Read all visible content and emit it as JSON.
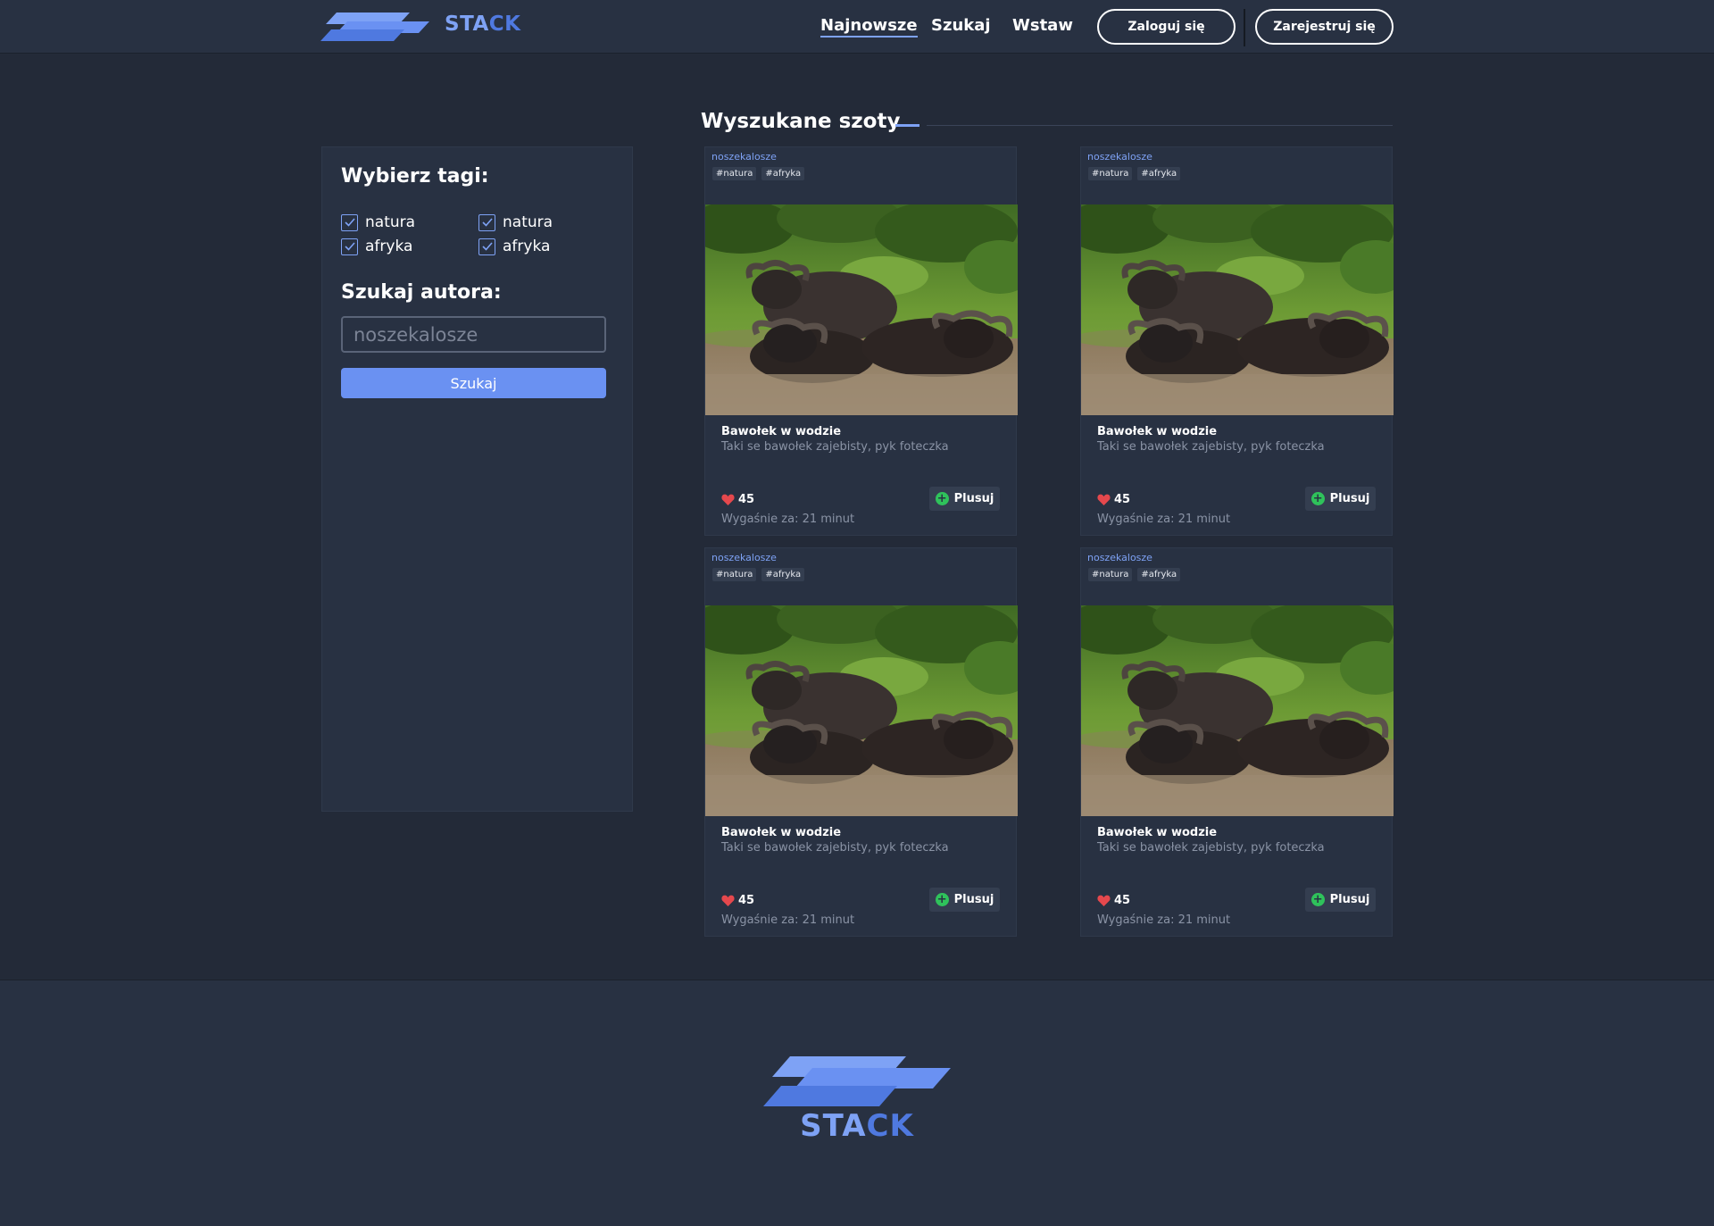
{
  "header": {
    "brand_part1": "STA",
    "brand_part2": "CK",
    "nav": [
      "Najnowsze",
      "Szukaj",
      "Wstaw"
    ],
    "login_label": "Zaloguj się",
    "register_label": "Zarejestruj się"
  },
  "main": {
    "section_title": "Wyszukane szoty"
  },
  "sidebar": {
    "tags_heading": "Wybierz tagi:",
    "tags": [
      {
        "label": "natura",
        "checked": true
      },
      {
        "label": "natura",
        "checked": true
      },
      {
        "label": "afryka",
        "checked": true
      },
      {
        "label": "afryka",
        "checked": true
      }
    ],
    "author_heading": "Szukaj autora:",
    "author_placeholder": "noszekalosze",
    "search_label": "Szukaj"
  },
  "cards": [
    {
      "author": "noszekalosze",
      "tags": [
        "#natura",
        "#afryka"
      ],
      "title": "Bawołek w wodzie",
      "description": "Taki se bawołek zajebisty, pyk foteczka",
      "likes": "45",
      "plus_label": "Plusuj",
      "expires": "Wygaśnie za: 21 minut"
    },
    {
      "author": "noszekalosze",
      "tags": [
        "#natura",
        "#afryka"
      ],
      "title": "Bawołek w wodzie",
      "description": "Taki se bawołek zajebisty, pyk foteczka",
      "likes": "45",
      "plus_label": "Plusuj",
      "expires": "Wygaśnie za: 21 minut"
    },
    {
      "author": "noszekalosze",
      "tags": [
        "#natura",
        "#afryka"
      ],
      "title": "Bawołek w wodzie",
      "description": "Taki se bawołek zajebisty, pyk foteczka",
      "likes": "45",
      "plus_label": "Plusuj",
      "expires": "Wygaśnie za: 21 minut"
    },
    {
      "author": "noszekalosze",
      "tags": [
        "#natura",
        "#afryka"
      ],
      "title": "Bawołek w wodzie",
      "description": "Taki se bawołek zajebisty, pyk foteczka",
      "likes": "45",
      "plus_label": "Plusuj",
      "expires": "Wygaśnie za: 21 minut"
    }
  ],
  "footer": {
    "brand_part1": "STA",
    "brand_part2": "CK"
  },
  "colors": {
    "background": "#232a38",
    "panel": "#283142",
    "accent": "#7ea2f5",
    "accent_dark": "#4f79e0",
    "button": "#6a91f2",
    "like": "#e5484d",
    "plus": "#2fc25b"
  }
}
